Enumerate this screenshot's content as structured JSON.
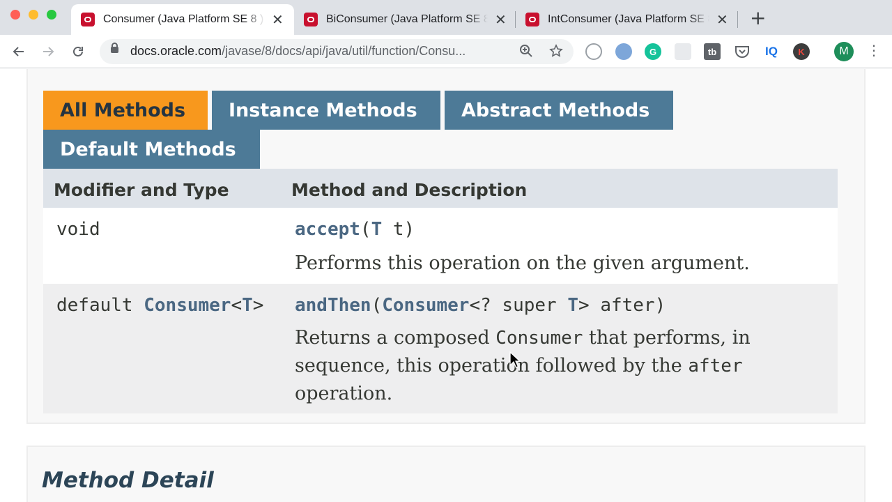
{
  "browser": {
    "tabs": [
      {
        "title": "Consumer (Java Platform SE 8 ) ",
        "active": true
      },
      {
        "title": "BiConsumer (Java Platform SE 8 )",
        "active": false
      },
      {
        "title": "IntConsumer (Java Platform SE 8 )",
        "active": false
      }
    ],
    "close_glyph": "✕",
    "new_tab_glyph": "+",
    "url_host": "docs.oracle.com",
    "url_path": "/javase/8/docs/api/java/util/function/Consu...",
    "extensions": [
      "G",
      "tb",
      "IQ",
      "K"
    ],
    "profile_initial": "M",
    "icons": [
      "back-icon",
      "forward-icon",
      "reload-icon",
      "lock-icon",
      "zoom-icon",
      "star-icon",
      "menu-icon"
    ]
  },
  "method_tabs": [
    "All Methods",
    "Instance Methods",
    "Abstract Methods",
    "Default Methods"
  ],
  "table": {
    "headers": [
      "Modifier and Type",
      "Method and Description"
    ],
    "rows": [
      {
        "type": "void",
        "method_name": "accept",
        "sig_open": "(",
        "param_type": "T",
        "sig_rest": " t)",
        "description": "Performs this operation on the given argument."
      },
      {
        "type_prefix": "default ",
        "type_link": "Consumer",
        "type_open": "<",
        "type_param": "T",
        "type_close": ">",
        "method_name": "andThen",
        "sig_open": "(",
        "param_link": "Consumer",
        "param_mid": "<? super ",
        "param_type": "T",
        "sig_rest": "> after)",
        "desc_1": "Returns a composed ",
        "desc_code_1": "Consumer",
        "desc_2": " that performs, in sequence, this operation followed by the ",
        "desc_code_2": "after",
        "desc_3": " operation."
      }
    ]
  },
  "detail": {
    "title": "Method Detail"
  },
  "colors": {
    "active_tab": "#f8981d",
    "inactive_tab": "#4d7a97",
    "link": "#4a6782",
    "header_bg": "#dee3e9"
  }
}
